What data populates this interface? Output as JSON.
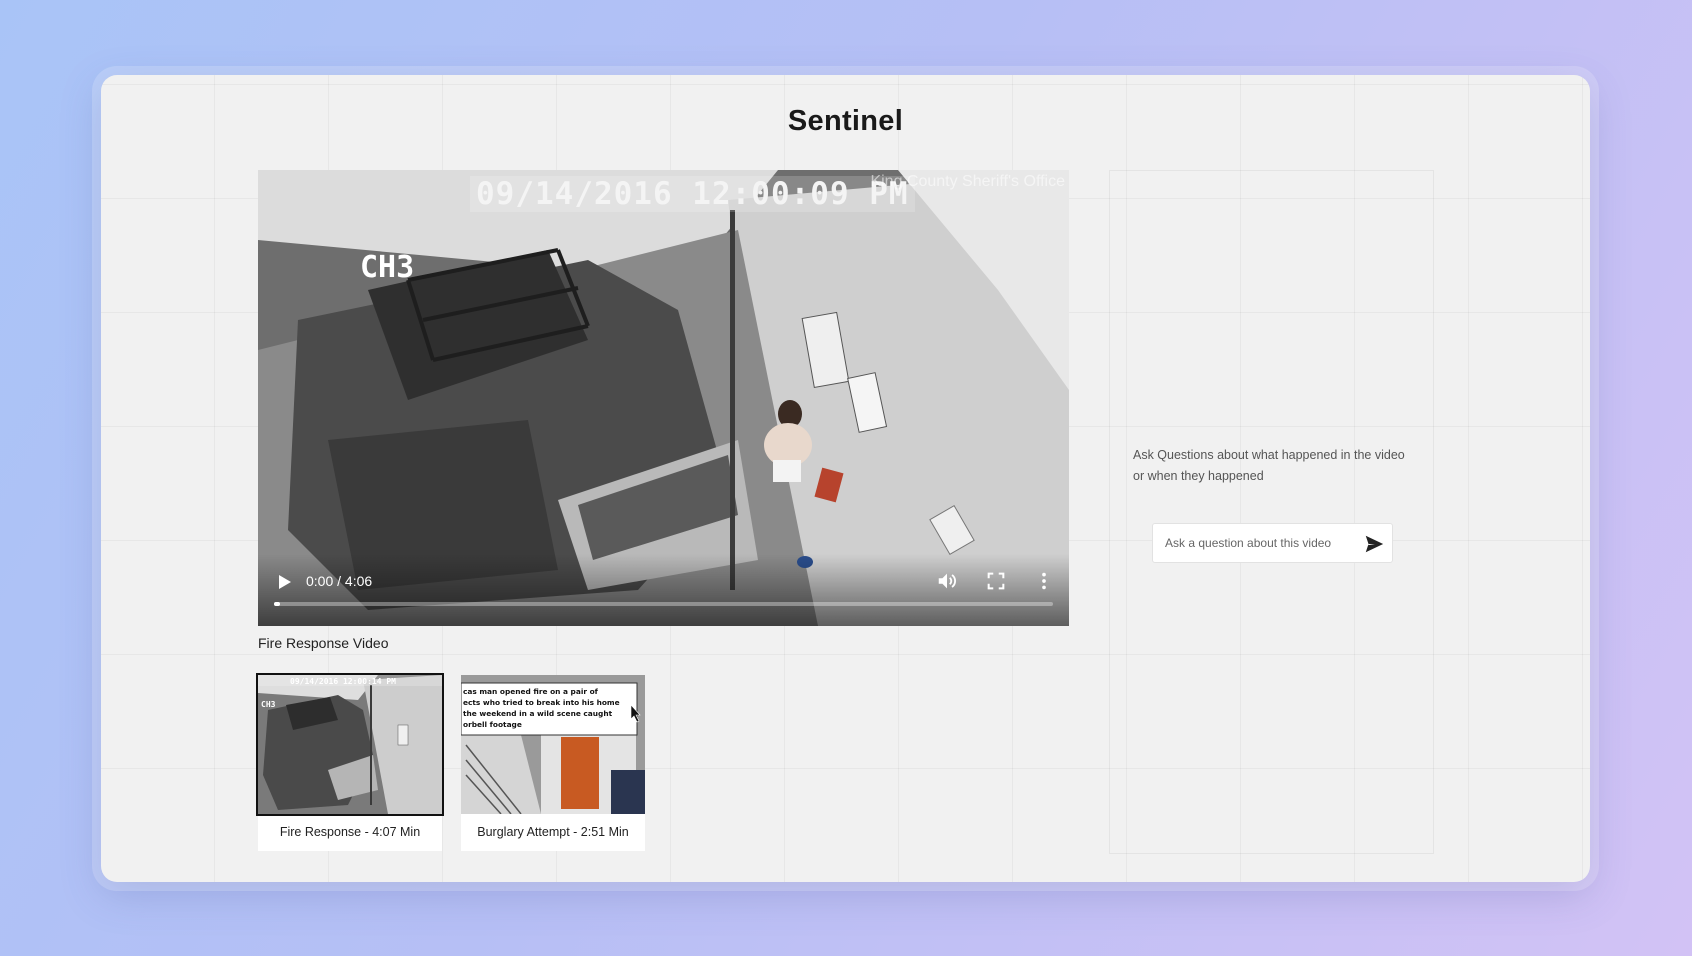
{
  "app": {
    "title": "Sentinel"
  },
  "player": {
    "timestamp_overlay": "09/14/2016 12:00:09 PM",
    "channel_overlay": "CH3",
    "watermark": "King County Sheriff's Office",
    "time_display": "0:00 / 4:06",
    "progress": 0.0,
    "caption": "Fire Response Video"
  },
  "thumbnails": [
    {
      "label": "Fire Response - 4:07 Min",
      "selected": true,
      "overlay_stamp": "09/14/2016 12:00:14 PM",
      "overlay_channel": "CH3"
    },
    {
      "label": "Burglary Attempt - 2:51 Min",
      "selected": false,
      "overlay_text_lines": [
        "cas man opened fire on a pair of",
        "ects who tried to break into his home",
        "the weekend in a wild scene caught",
        "orbell footage"
      ]
    }
  ],
  "chat": {
    "hint": "Ask Questions about what happened in the video or when they happened",
    "placeholder": "Ask a question about this video"
  },
  "icons": {
    "play": "play-icon",
    "volume": "volume-icon",
    "fullscreen": "fullscreen-icon",
    "more": "more-vert-icon",
    "send": "send-icon"
  },
  "colors": {
    "window_bg": "#f1f1f1",
    "progress_track": "#ffffff",
    "text_primary": "#1a1a1a"
  }
}
